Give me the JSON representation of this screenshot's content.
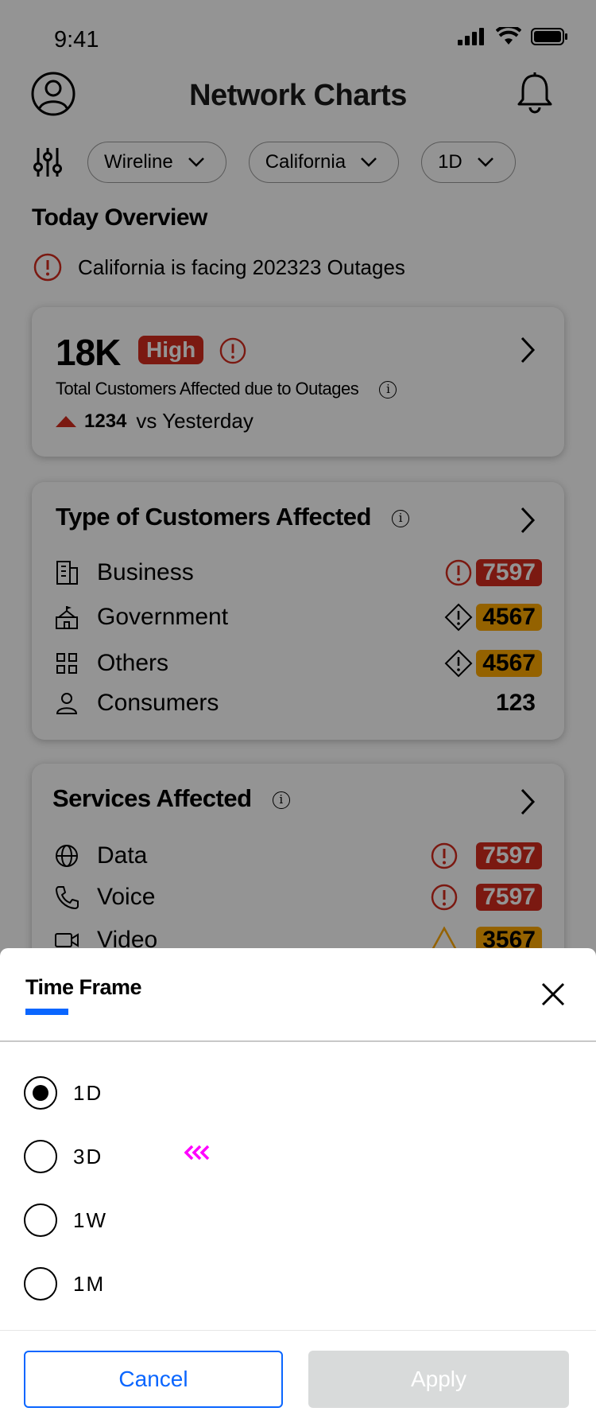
{
  "status_bar": {
    "time": "9:41"
  },
  "header": {
    "title": "Network Charts"
  },
  "filters": [
    {
      "label": "Wireline"
    },
    {
      "label": "California"
    },
    {
      "label": "1D"
    }
  ],
  "overview": {
    "title": "Today Overview",
    "alert_text": "California is facing 202323 Outages"
  },
  "card_customers": {
    "value": "18K",
    "severity": "High",
    "subtitle": "Total Customers Affected due to Outages",
    "delta": "1234",
    "delta_label": "vs Yesterday"
  },
  "card_types": {
    "title": "Type of Customers Affected",
    "rows": [
      {
        "label": "Business",
        "value": "7597",
        "level": "critical"
      },
      {
        "label": "Government",
        "value": "4567",
        "level": "warning"
      },
      {
        "label": "Others",
        "value": "4567",
        "level": "warning"
      },
      {
        "label": "Consumers",
        "value": "123",
        "level": "normal"
      }
    ]
  },
  "card_services": {
    "title": "Services Affected",
    "rows": [
      {
        "label": "Data",
        "value": "7597",
        "level": "critical"
      },
      {
        "label": "Voice",
        "value": "7597",
        "level": "critical"
      },
      {
        "label": "Video",
        "value": "3567",
        "level": "warning"
      }
    ]
  },
  "sheet": {
    "title": "Time Frame",
    "options": [
      {
        "label": "1D",
        "selected": true
      },
      {
        "label": "3D",
        "selected": false
      },
      {
        "label": "1W",
        "selected": false
      },
      {
        "label": "1M",
        "selected": false
      }
    ],
    "cancel_label": "Cancel",
    "apply_label": "Apply"
  },
  "colors": {
    "brand_red": "#d52b1e",
    "warning_amber": "#ffa900",
    "accent_blue": "#0a66ff",
    "disabled_gray": "#d8dada",
    "cursor_magenta": "#ff00ff"
  }
}
